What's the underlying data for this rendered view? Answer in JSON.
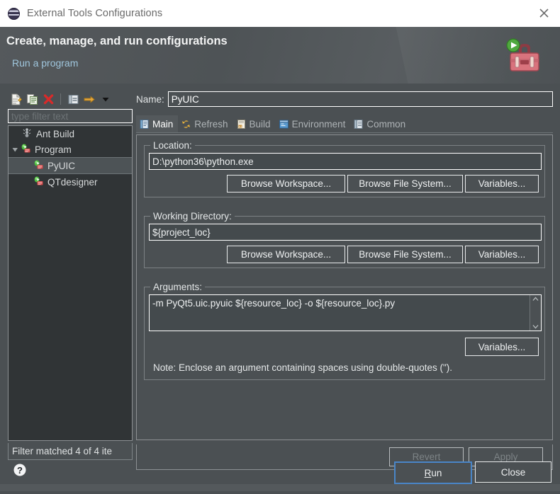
{
  "window": {
    "title": "External Tools Configurations",
    "app_icon": "eclipse-icon",
    "close_label": "✕"
  },
  "header": {
    "title": "Create, manage, and run configurations",
    "subtitle": "Run a program",
    "icon": "toolbox-run-icon"
  },
  "left_panel": {
    "toolbar": [
      {
        "name": "new-configuration-icon",
        "tooltip": "New launch configuration"
      },
      {
        "name": "duplicate-configuration-icon",
        "tooltip": "Duplicate"
      },
      {
        "name": "delete-configuration-icon",
        "tooltip": "Delete"
      },
      {
        "name": "collapse-all-icon",
        "tooltip": "Collapse All"
      },
      {
        "name": "filter-arrow-icon",
        "tooltip": "Filter"
      },
      {
        "name": "chevron-down-icon",
        "tooltip": "View Menu"
      }
    ],
    "filter": {
      "placeholder": "type filter text",
      "value": ""
    },
    "tree": [
      {
        "label": "Ant Build",
        "icon": "ant-build-icon",
        "depth": 0,
        "expandable": false,
        "selected": false
      },
      {
        "label": "Program",
        "icon": "program-icon",
        "depth": 0,
        "expandable": true,
        "expanded": true,
        "selected": false
      },
      {
        "label": "PyUIC",
        "icon": "program-icon",
        "depth": 1,
        "expandable": false,
        "selected": true
      },
      {
        "label": "QTdesigner",
        "icon": "program-icon",
        "depth": 1,
        "expandable": false,
        "selected": false
      }
    ],
    "status": "Filter matched 4 of 4 ite"
  },
  "config": {
    "name_label": "Name:",
    "name_value": "PyUIC",
    "tabs": [
      {
        "label": "Main",
        "icon": "main-tab-icon",
        "active": true
      },
      {
        "label": "Refresh",
        "icon": "refresh-tab-icon",
        "active": false
      },
      {
        "label": "Build",
        "icon": "build-tab-icon",
        "active": false
      },
      {
        "label": "Environment",
        "icon": "environment-tab-icon",
        "active": false
      },
      {
        "label": "Common",
        "icon": "common-tab-icon",
        "active": false
      }
    ],
    "location": {
      "group_label": "Location:",
      "value": "D:\\python36\\python.exe",
      "browse_workspace": "Browse Workspace...",
      "browse_filesystem": "Browse File System...",
      "variables": "Variables..."
    },
    "working_directory": {
      "group_label": "Working Directory:",
      "value": "${project_loc}",
      "browse_workspace": "Browse Workspace...",
      "browse_filesystem": "Browse File System...",
      "variables": "Variables..."
    },
    "arguments": {
      "group_label": "Arguments:",
      "value": "-m PyQt5.uic.pyuic ${resource_loc} -o ${resource_loc}.py",
      "variables": "Variables...",
      "note": "Note: Enclose an argument containing spaces using double-quotes (\")."
    },
    "revert_label": "Revert",
    "apply_label": "Apply",
    "revert_enabled": false,
    "apply_enabled": false
  },
  "footer": {
    "help_icon": "help-icon",
    "run_label": "Run",
    "run_mnemonic": "R",
    "close_label": "Close"
  },
  "colors": {
    "window_bg": "#4b5053",
    "titlebar_bg": "#ffffff",
    "header_text": "#f2f3f3",
    "link_text": "#9fc6dd",
    "tree_bg": "#303436",
    "input_bg": "#444a4d",
    "focus_border": "#4a86c8",
    "disabled_text": "#7d8386"
  }
}
